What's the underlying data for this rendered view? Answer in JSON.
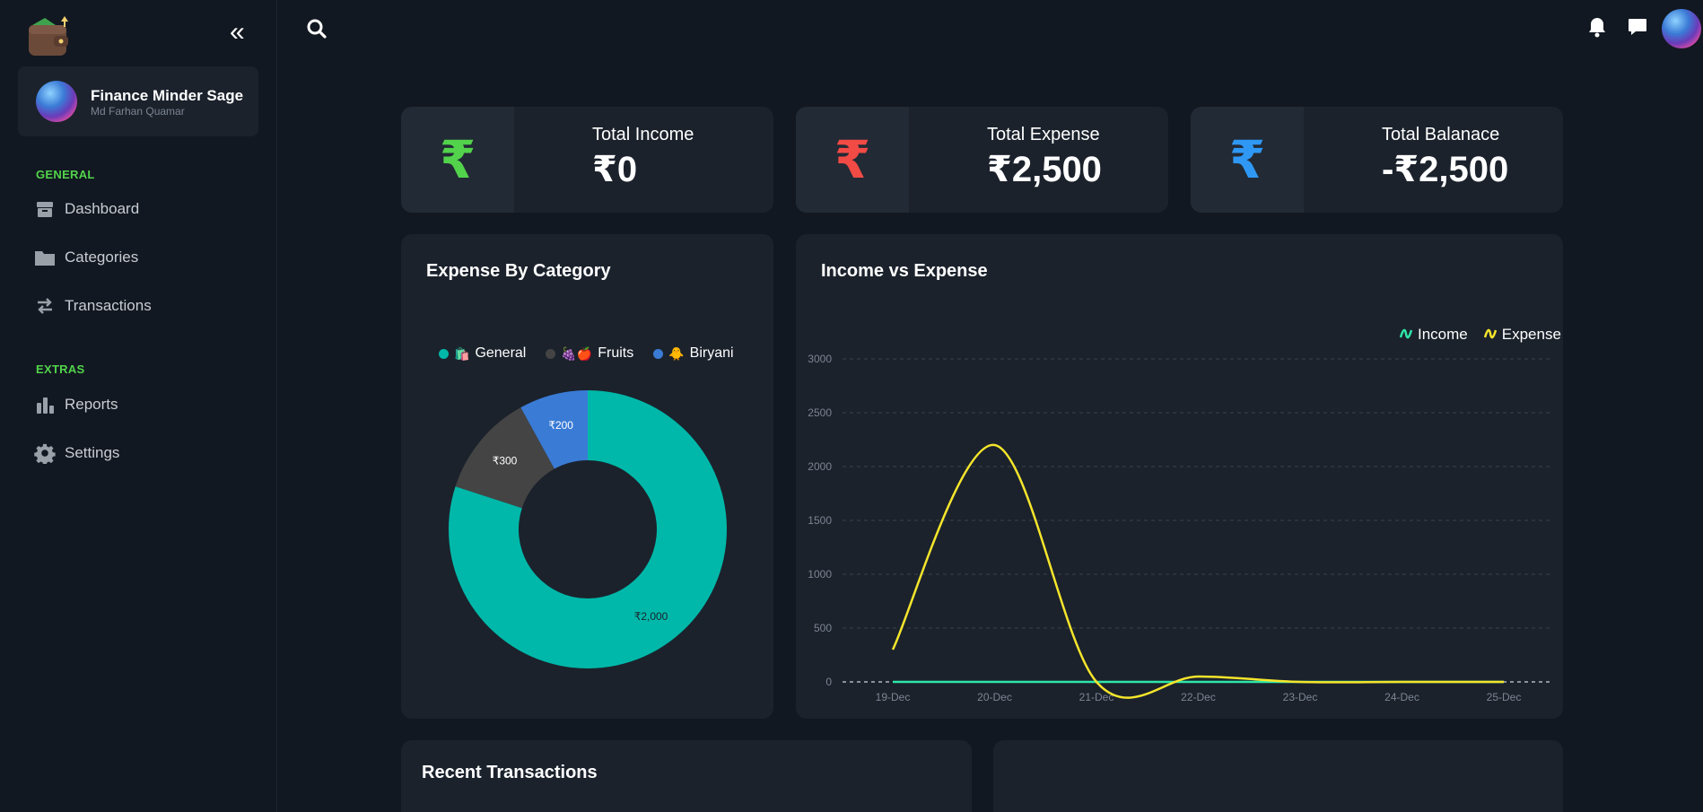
{
  "app": {
    "name": "Finance Minder Sage",
    "user": "Md Farhan Quamar"
  },
  "sidebar": {
    "sections": [
      {
        "label": "GENERAL"
      },
      {
        "label": "EXTRAS"
      }
    ],
    "items": [
      {
        "label": "Dashboard",
        "icon": "box-icon"
      },
      {
        "label": "Categories",
        "icon": "folder-icon"
      },
      {
        "label": "Transactions",
        "icon": "swap-arrows-icon"
      },
      {
        "label": "Reports",
        "icon": "bar-chart-icon"
      },
      {
        "label": "Settings",
        "icon": "gear-icon"
      }
    ]
  },
  "stats": [
    {
      "label": "Total Income",
      "value": "₹0",
      "symbol": "₹",
      "color": "#52d34b"
    },
    {
      "label": "Total Expense",
      "value": "₹2,500",
      "symbol": "₹",
      "color": "#f24a45"
    },
    {
      "label": "Total Balanace",
      "value": "-₹2,500",
      "symbol": "₹",
      "color": "#2f98f5"
    }
  ],
  "panels": {
    "expense_by_category": "Expense By Category",
    "income_vs_expense": "Income vs Expense",
    "recent_transactions": "Recent Transactions"
  },
  "chart_data": [
    {
      "type": "pie",
      "variant": "donut",
      "title": "Expense By Category",
      "legend_position": "top",
      "slices": [
        {
          "name": "General",
          "emoji": "🛍️",
          "value": 2000,
          "label": "₹2,000",
          "color": "#00b8a9"
        },
        {
          "name": "Fruits",
          "emoji": "🍇🍎",
          "value": 300,
          "label": "₹300",
          "color": "#444444"
        },
        {
          "name": "Biryani",
          "emoji": "🐥",
          "value": 200,
          "label": "₹200",
          "color": "#3a7bd5"
        }
      ]
    },
    {
      "type": "line",
      "title": "Income vs Expense",
      "legend_position": "top-right",
      "grid": true,
      "categories": [
        "19-Dec",
        "20-Dec",
        "21-Dec",
        "22-Dec",
        "23-Dec",
        "24-Dec",
        "25-Dec"
      ],
      "yticks": [
        "0",
        "500",
        "1000",
        "1500",
        "2000",
        "2500",
        "3000"
      ],
      "ylim": [
        0,
        3000
      ],
      "series": [
        {
          "name": "Income",
          "color": "#2ee6a8",
          "values": [
            0,
            0,
            0,
            0,
            0,
            0,
            0
          ]
        },
        {
          "name": "Expense",
          "color": "#f5e52b",
          "values": [
            300,
            2200,
            0,
            50,
            0,
            0,
            0
          ]
        }
      ]
    }
  ]
}
